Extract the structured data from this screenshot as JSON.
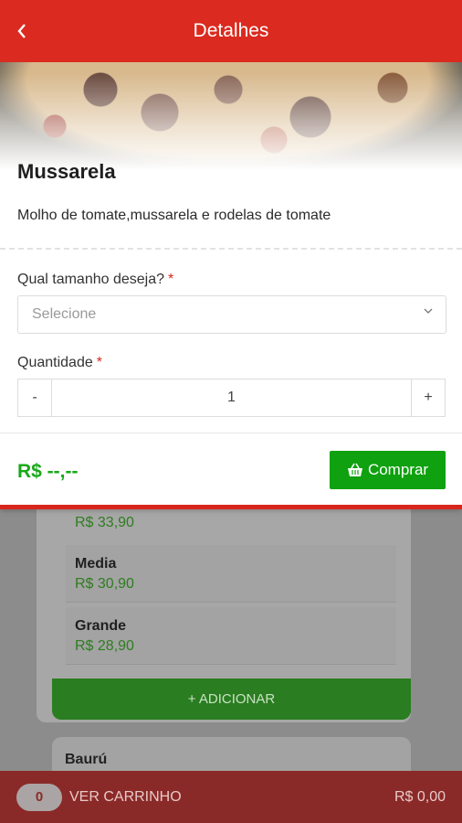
{
  "header": {
    "title": "Detalhes",
    "back_icon": "chevron-left-icon"
  },
  "product": {
    "name": "Mussarela",
    "description": "Molho de tomate,mussarela e rodelas de tomate"
  },
  "form": {
    "size_label": "Qual tamanho deseja?",
    "size_required": "*",
    "size_placeholder": "Selecione",
    "quantity_label": "Quantidade",
    "quantity_required": "*",
    "quantity_minus": "-",
    "quantity_value": "1",
    "quantity_plus": "+"
  },
  "footer": {
    "price": "R$ --,--",
    "buy_label": "Comprar",
    "buy_icon": "basket-icon"
  },
  "background_list": {
    "first_price": "R$ 33,90",
    "options": [
      {
        "name": "Media",
        "price": "R$ 30,90"
      },
      {
        "name": "Grande",
        "price": "R$ 28,90"
      }
    ],
    "add_label": "+ ADICIONAR",
    "next_item_title": "Baurú"
  },
  "cart": {
    "count": "0",
    "label": "VER CARRINHO",
    "total": "R$ 0,00"
  },
  "colors": {
    "primary_red": "#db2a1f",
    "green": "#0fa10f",
    "price_green": "#18a818"
  }
}
